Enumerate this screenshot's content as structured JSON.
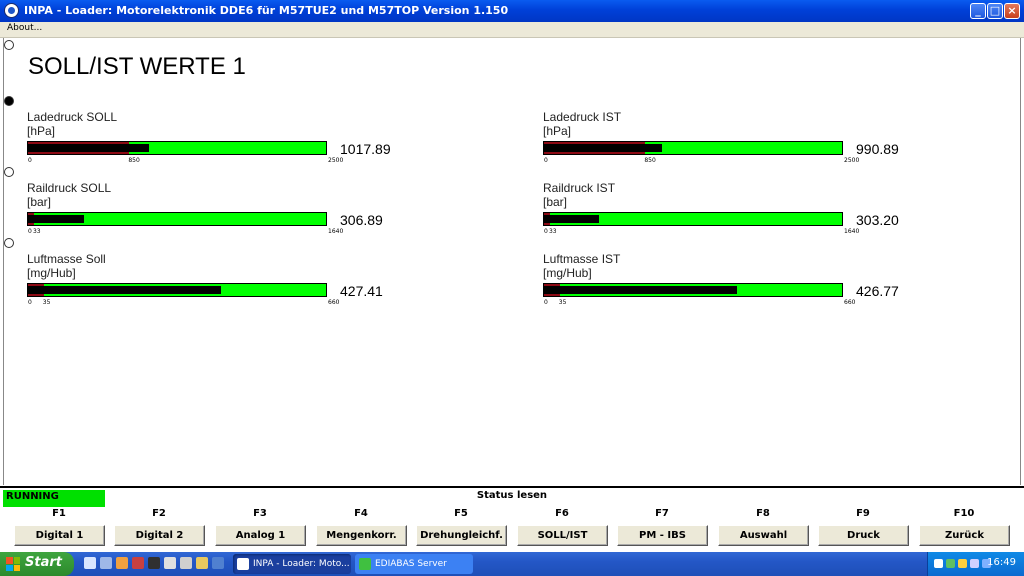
{
  "window": {
    "title": "INPA - Loader:  Motorelektronik DDE6 für M57TUE2 und M57TOP Version 1.150",
    "menu": [
      "About..."
    ],
    "controls": [
      "minimize",
      "maximize",
      "close"
    ]
  },
  "page": {
    "title": "SOLL/IST WERTE 1"
  },
  "gauges": [
    {
      "label": "Ladedruck SOLL",
      "unit": "[hPa]",
      "value": "1017.89",
      "min": "0",
      "mark": "850",
      "max": "2500",
      "fill": 0.407,
      "red": 0.34
    },
    {
      "label": "Ladedruck IST",
      "unit": "[hPa]",
      "value": "990.89",
      "min": "0",
      "mark": "850",
      "max": "2500",
      "fill": 0.396,
      "red": 0.34
    },
    {
      "label": "Raildruck SOLL",
      "unit": "[bar]",
      "value": "306.89",
      "min": "0",
      "mark": "33",
      "max": "1640",
      "fill": 0.187,
      "red": 0.02
    },
    {
      "label": "Raildruck IST",
      "unit": "[bar]",
      "value": "303.20",
      "min": "0",
      "mark": "33",
      "max": "1640",
      "fill": 0.185,
      "red": 0.02
    },
    {
      "label": "Luftmasse Soll",
      "unit": "[mg/Hub]",
      "value": "427.41",
      "min": "0",
      "mark": "35",
      "max": "660",
      "fill": 0.648,
      "red": 0.053
    },
    {
      "label": "Luftmasse IST",
      "unit": "[mg/Hub]",
      "value": "426.77",
      "min": "0",
      "mark": "35",
      "max": "660",
      "fill": 0.647,
      "red": 0.053
    }
  ],
  "status": {
    "running": "RUNNING",
    "center": "Status lesen"
  },
  "fkeys": [
    {
      "key": "F1",
      "label": "Digital 1"
    },
    {
      "key": "F2",
      "label": "Digital 2"
    },
    {
      "key": "F3",
      "label": "Analog 1"
    },
    {
      "key": "F4",
      "label": "Mengenkorr."
    },
    {
      "key": "F5",
      "label": "Drehungleichf."
    },
    {
      "key": "F6",
      "label": "SOLL/IST"
    },
    {
      "key": "F7",
      "label": "PM - IBS"
    },
    {
      "key": "F8",
      "label": "Auswahl"
    },
    {
      "key": "F9",
      "label": "Druck"
    },
    {
      "key": "F10",
      "label": "Zurück"
    }
  ],
  "taskbar": {
    "start": "Start",
    "tasks": [
      "INPA - Loader: Moto...",
      "EDIABAS Server"
    ],
    "clock": "16:49"
  },
  "colors": {
    "bar_green": "#00ff00",
    "bar_red": "#8c0a14",
    "running_green": "#00e000",
    "titlebar_blue": "#0a5bf0"
  }
}
